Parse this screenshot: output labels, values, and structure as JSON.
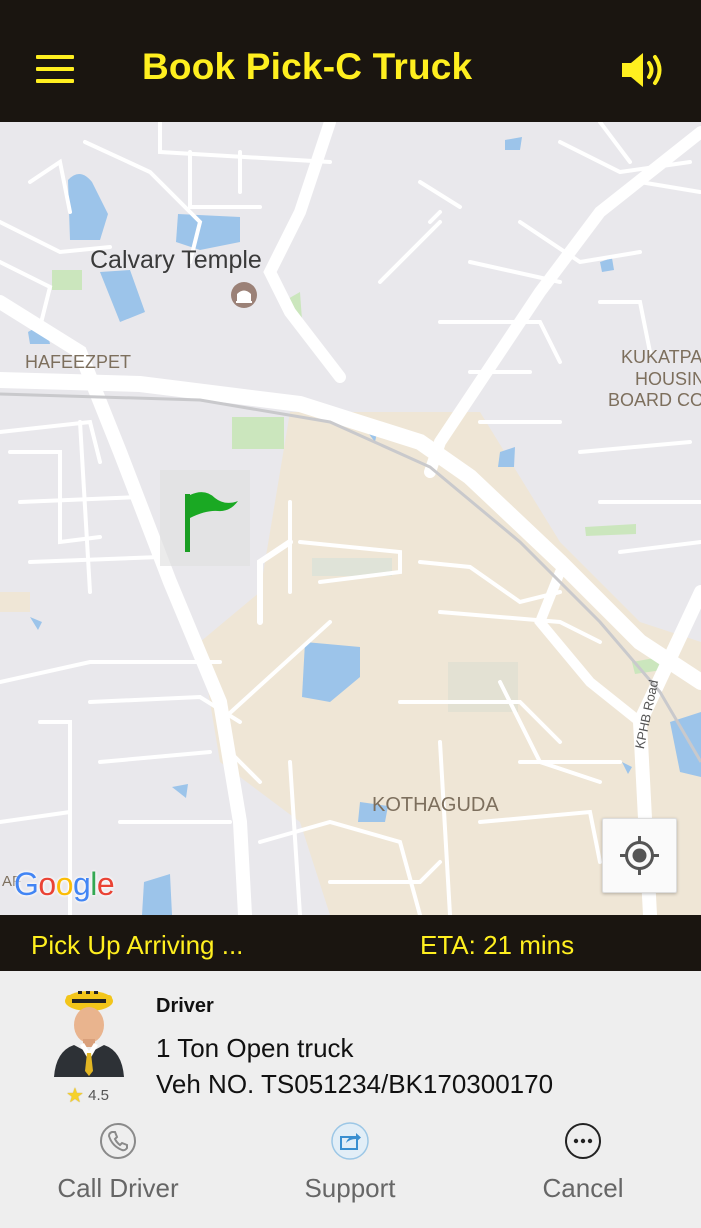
{
  "header": {
    "title": "Book Pick-C Truck",
    "menu_icon": "hamburger-menu-icon",
    "sound_icon": "speaker-volume-icon",
    "accent_color": "#ffef1f",
    "background_color": "#1a1510"
  },
  "map": {
    "labels": {
      "calvary_temple": "Calvary Temple",
      "hafeezpet": "HAFEEZPET",
      "kukatpally_line1": "KUKATPA",
      "kukatpally_line2": "HOUSIN",
      "kukatpally_line3": "BOARD COL",
      "kothaguda": "KOTHAGUDA",
      "kphb_road": "KPHB Road",
      "partial_left": "AF"
    },
    "attribution": "Google",
    "pickup_marker_icon": "green-flag-icon",
    "locate_button_icon": "my-location-icon"
  },
  "status": {
    "text": "Pick Up Arriving ...",
    "eta": "ETA: 21 mins"
  },
  "driver": {
    "heading": "Driver",
    "vehicle_type": "1 Ton Open truck",
    "vehicle_number": "Veh NO. TS051234/BK170300170",
    "rating": "4.5",
    "avatar_icon": "driver-avatar-icon"
  },
  "actions": [
    {
      "label": "Call Driver",
      "icon": "phone-icon"
    },
    {
      "label": "Support",
      "icon": "share-icon"
    },
    {
      "label": "Cancel",
      "icon": "more-dots-icon"
    }
  ]
}
